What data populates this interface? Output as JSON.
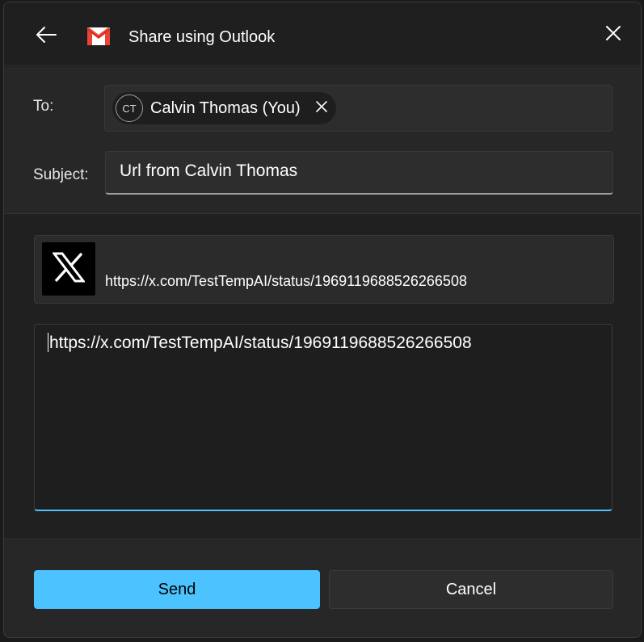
{
  "title": "Share using Outlook",
  "icons": {
    "back": "back-arrow-icon",
    "app": "gmail-icon",
    "close": "close-icon",
    "remove_recipient": "remove-icon",
    "link_thumbnail": "x-logo-icon"
  },
  "colors": {
    "accent": "#4cc2ff",
    "dialog_bg": "#202020",
    "field_bg": "#2d2d2d",
    "gmail_red": "#ea4335"
  },
  "to": {
    "label": "To:",
    "recipients": [
      {
        "initials": "CT",
        "name": "Calvin Thomas (You)"
      }
    ]
  },
  "subject": {
    "label": "Subject:",
    "value": "Url from Calvin Thomas"
  },
  "link_preview": {
    "url": "https://x.com/TestTempAI/status/1969119688526266508"
  },
  "message": {
    "value": "https://x.com/TestTempAI/status/1969119688526266508"
  },
  "buttons": {
    "send": "Send",
    "cancel": "Cancel"
  }
}
